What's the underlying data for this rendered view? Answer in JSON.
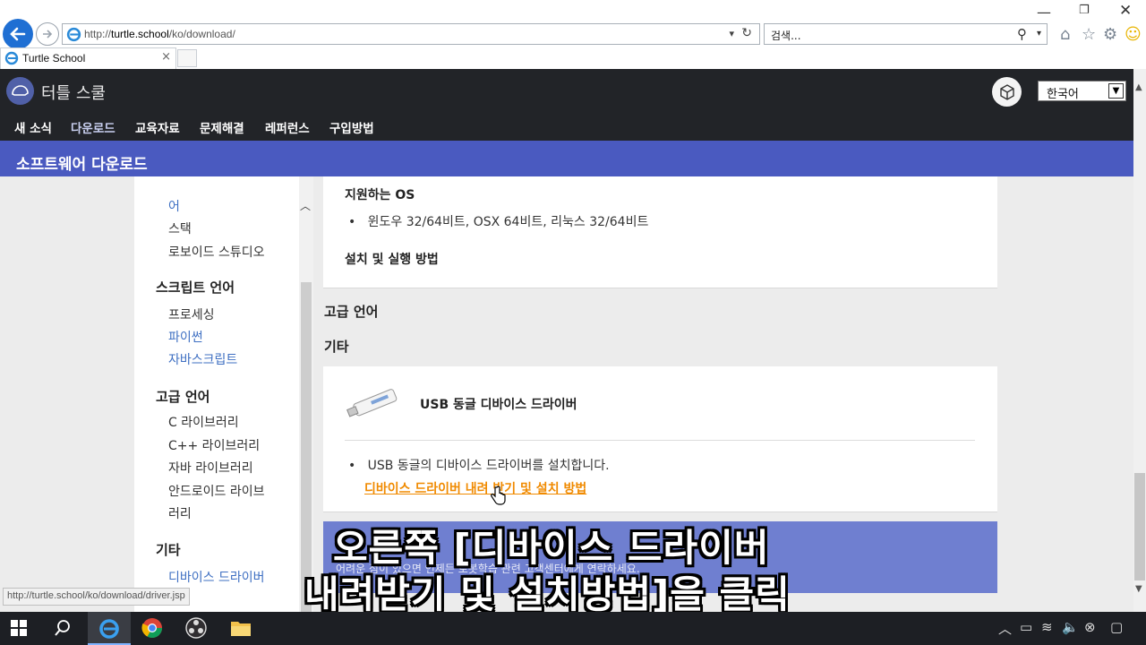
{
  "browser": {
    "address": {
      "prefix": "http://",
      "host": "turtle.school",
      "path": "/ko/download/"
    },
    "search_placeholder": "검색...",
    "tab_title": "Turtle School",
    "status_url": "http://turtle.school/ko/download/driver.jsp"
  },
  "site": {
    "logo_text": "터틀 스쿨",
    "language": "한국어",
    "nav": [
      "새 소식",
      "다운로드",
      "교육자료",
      "문제해결",
      "레퍼런스",
      "구입방법"
    ],
    "banner_title": "소프트웨어 다운로드"
  },
  "sidebar": {
    "partial_top": "어",
    "items_group1": [
      "스택",
      "로보이드 스튜디오"
    ],
    "head_script": "스크립트 언어",
    "items_script": [
      "프로세싱",
      "파이썬",
      "자바스크립트"
    ],
    "head_high": "고급 언어",
    "items_high": [
      "C 라이브러리",
      "C++ 라이브러리",
      "자바 라이브러리",
      "안드로이드 라이브",
      "러리"
    ],
    "head_etc": "기타",
    "items_etc": [
      "디바이스 드라이버"
    ]
  },
  "content": {
    "supported_os_head": "지원하는 OS",
    "supported_os_bullet": "윈도우 32/64비트, OSX 64비트, 리눅스 32/64비트",
    "install_head": "설치 및 실행 방법",
    "section_high": "고급 언어",
    "section_etc": "기타",
    "usb_title": "USB 동글 디바이스 드라이버",
    "usb_desc": "USB 동글의 디바이스 드라이버를 설치합니다.",
    "usb_link": "디바이스 드라이버 내려 받기 및 설치 방법",
    "footer_text": "어려운 점이 있으면 언제든 로봇학습 관련 고객센터에게 연락하세요."
  },
  "subtitle": {
    "line1": "오른쪽 [디바이스 드라이버",
    "line2": "내려받기 및 설치방법]을 클릭"
  },
  "colors": {
    "header_bg": "#222428",
    "banner_bg": "#4a5ac0",
    "link_orange": "#f08a00",
    "footer_bg": "#6f7fd0"
  }
}
